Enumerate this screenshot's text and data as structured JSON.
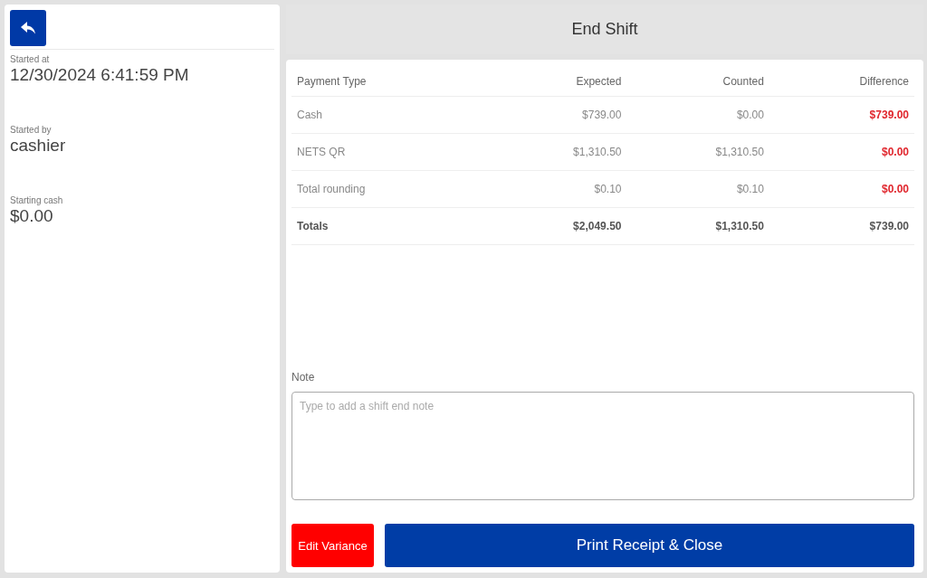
{
  "sidebar": {
    "fields": [
      {
        "label": "Started at",
        "value": "12/30/2024 6:41:59 PM"
      },
      {
        "label": "Started by",
        "value": "cashier"
      },
      {
        "label": "Starting cash",
        "value": "$0.00"
      }
    ]
  },
  "header": {
    "title": "End Shift"
  },
  "table": {
    "columns": [
      "Payment Type",
      "Expected",
      "Counted",
      "Difference"
    ],
    "rows": [
      {
        "kind": "item",
        "cells": [
          "Cash",
          "$739.00",
          "$0.00",
          "$739.00"
        ]
      },
      {
        "kind": "item",
        "cells": [
          "NETS QR",
          "$1,310.50",
          "$1,310.50",
          "$0.00"
        ]
      },
      {
        "kind": "item",
        "cells": [
          "Total rounding",
          "$0.10",
          "$0.10",
          "$0.00"
        ]
      },
      {
        "kind": "total",
        "cells": [
          "Totals",
          "$2,049.50",
          "$1,310.50",
          "$739.00"
        ]
      }
    ]
  },
  "note": {
    "label": "Note",
    "placeholder": "Type to add a shift end note"
  },
  "buttons": [
    {
      "kind": "danger",
      "label": "Edit Variance"
    },
    {
      "kind": "primary",
      "label": "Print Receipt & Close"
    }
  ]
}
